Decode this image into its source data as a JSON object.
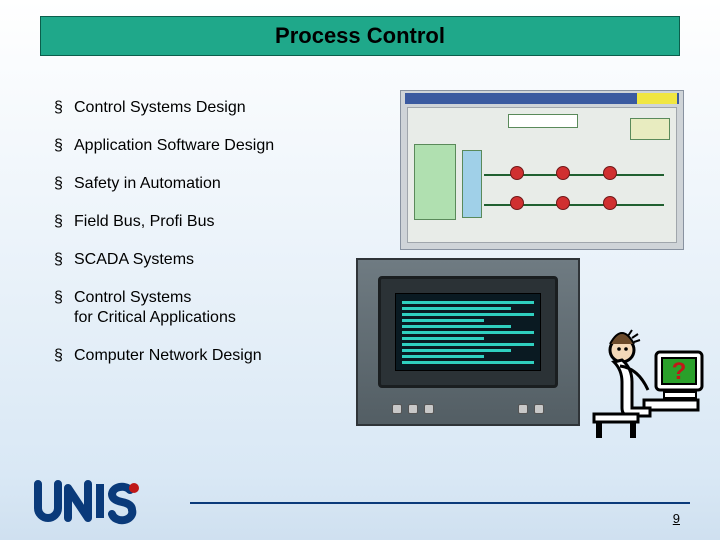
{
  "title": "Process Control",
  "bullets": [
    "Control Systems Design",
    "Application Software Design",
    "Safety in Automation",
    "Field Bus, Profi Bus",
    "SCADA Systems",
    "Control Systems\nfor Critical Applications",
    "Computer Network Design"
  ],
  "images": {
    "scada_diagram": "scada-process-diagram",
    "control_panel": "industrial-control-panel-photo",
    "clipart": "confused-user-at-computer-question-mark"
  },
  "logo_text": "UNIS",
  "page_number": "9",
  "colors": {
    "title_bg": "#1fa88a",
    "accent_blue": "#0a3a7a"
  }
}
